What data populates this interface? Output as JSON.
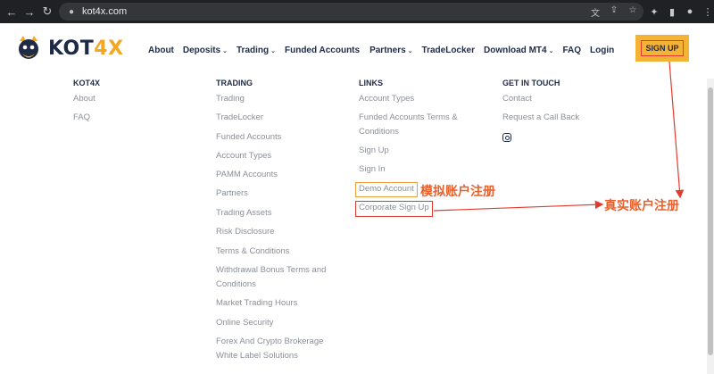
{
  "browser": {
    "url": "kot4x.com",
    "icons": [
      "back-icon",
      "forward-icon",
      "reload-icon",
      "home-icon",
      "lock-icon",
      "translate-icon",
      "share-icon",
      "star-icon",
      "extensions-icon",
      "sidebar-icon",
      "profile-icon",
      "menu-icon"
    ]
  },
  "header": {
    "logo_text_main": "KOT",
    "logo_text_accent": "4X",
    "nav": [
      {
        "label": "About",
        "dropdown": false
      },
      {
        "label": "Deposits",
        "dropdown": true
      },
      {
        "label": "Trading",
        "dropdown": true
      },
      {
        "label": "Funded Accounts",
        "dropdown": false
      },
      {
        "label": "Partners",
        "dropdown": true
      },
      {
        "label": "TradeLocker",
        "dropdown": false
      },
      {
        "label": "Download MT4",
        "dropdown": true
      },
      {
        "label": "FAQ",
        "dropdown": false
      },
      {
        "label": "Login",
        "dropdown": false
      }
    ],
    "signup_label": "SIGN UP"
  },
  "footer": {
    "kot4x": {
      "title": "KOT4X",
      "links": [
        "About",
        "FAQ"
      ]
    },
    "trading": {
      "title": "TRADING",
      "links": [
        "Trading",
        "TradeLocker",
        "Funded Accounts",
        "Account Types",
        "PAMM Accounts",
        "Partners",
        "Trading Assets",
        "Risk Disclosure",
        "Terms & Conditions",
        "Withdrawal Bonus Terms and",
        "Conditions",
        "Market Trading Hours",
        "Online Security",
        "Forex And Crypto Brokerage",
        "White Label Solutions"
      ]
    },
    "links": {
      "title": "LINKS",
      "links": [
        "Account Types",
        "Funded Accounts Terms &",
        "Conditions",
        "Sign Up",
        "Sign In",
        "Demo Account",
        "Corporate Sign Up"
      ]
    },
    "contact": {
      "title": "GET IN TOUCH",
      "links": [
        "Contact",
        "Request a Call Back"
      ]
    }
  },
  "annotations": {
    "demo_label": "模拟账户注册",
    "real_label": "真实账户注册"
  },
  "colors": {
    "brand_navy": "#1f2a44",
    "brand_orange": "#f5b335",
    "annotation_red": "#e23b2e",
    "annotation_orange": "#e8612c"
  }
}
